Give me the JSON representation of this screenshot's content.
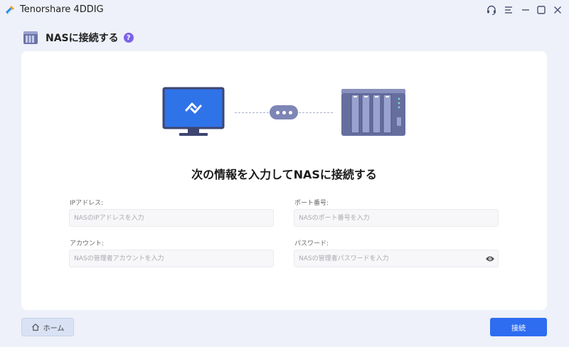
{
  "window": {
    "title": "Tenorshare 4DDIG",
    "controls": [
      "headset-icon",
      "menu-icon",
      "minimize-icon",
      "maximize-icon",
      "close-icon"
    ]
  },
  "header": {
    "title": "NASに接続する",
    "help_badge": "?"
  },
  "form": {
    "title": "次の情報を入力してNASに接続する",
    "ip": {
      "label": "IPアドレス:",
      "placeholder": "NASのIPアドレスを入力",
      "value": ""
    },
    "port": {
      "label": "ポート番号:",
      "placeholder": "NASのポート番号を入力",
      "value": ""
    },
    "account": {
      "label": "アカウント:",
      "placeholder": "NASの管理者アカウントを入力",
      "value": ""
    },
    "password": {
      "label": "パスワード:",
      "placeholder": "NASの管理者パスワードを入力",
      "value": ""
    }
  },
  "footer": {
    "home_label": "ホーム",
    "connect_label": "接続"
  },
  "colors": {
    "accent": "#2e6cf0",
    "help_badge": "#7b62e8",
    "background": "#eef1f9",
    "card": "#ffffff",
    "illustration": "#7d86b5"
  }
}
